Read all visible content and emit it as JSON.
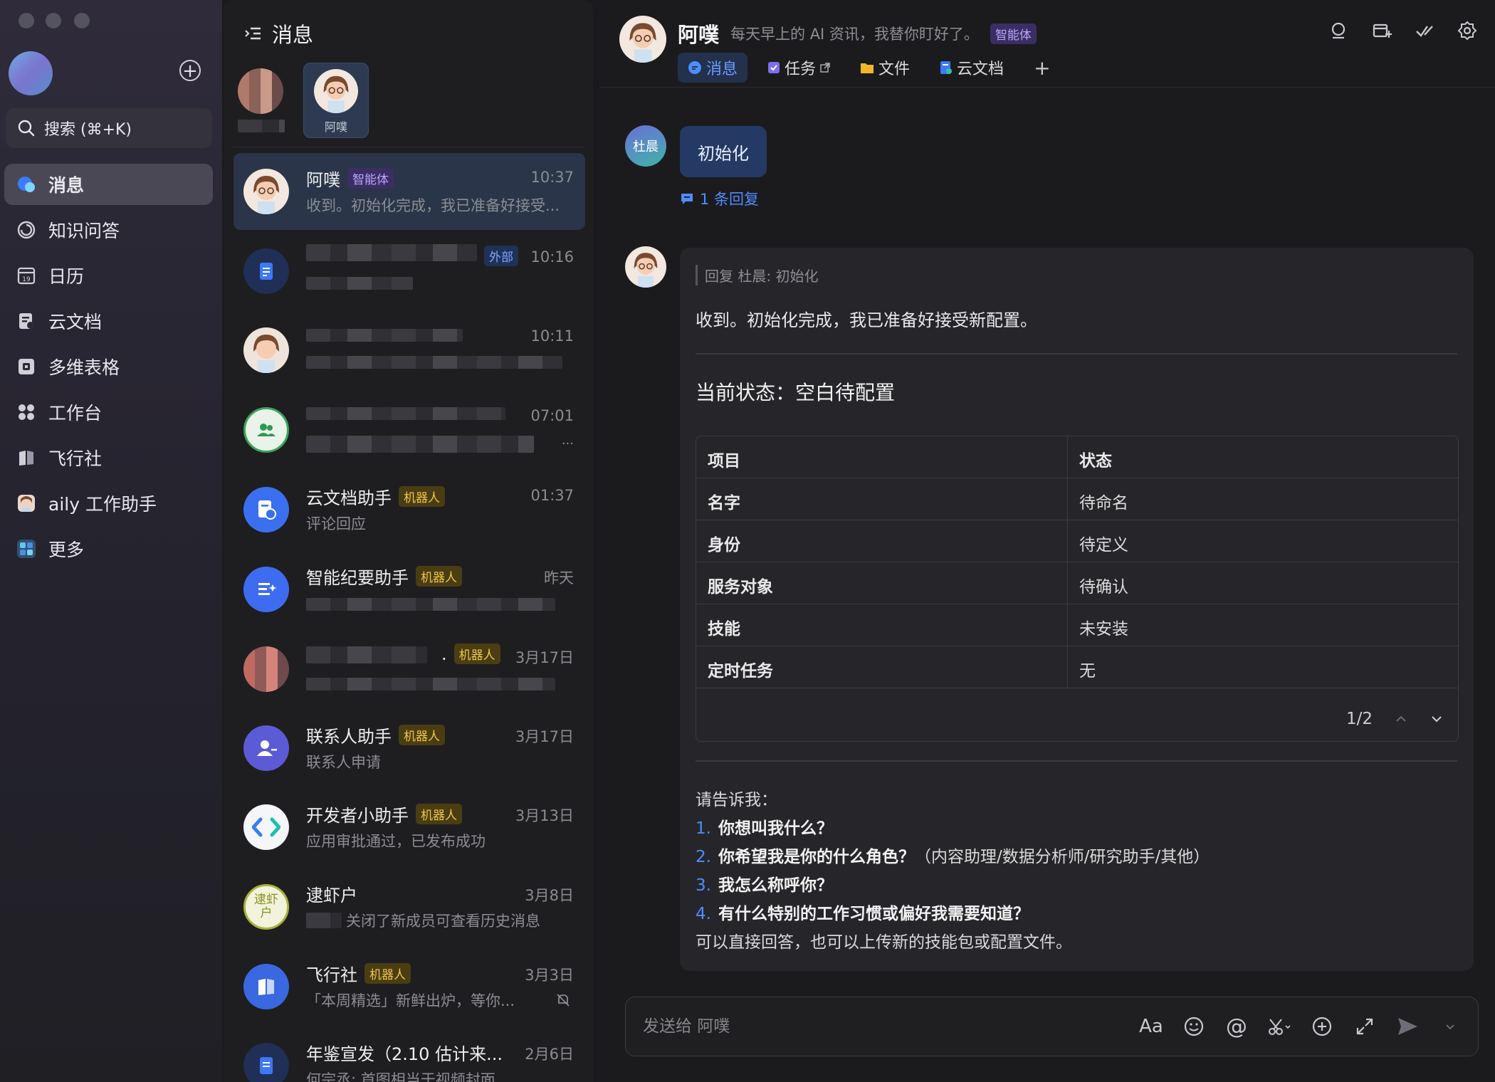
{
  "sidebar": {
    "search_label": "搜索 (⌘+K)",
    "items": [
      {
        "label": "消息",
        "icon": "chat-bubble-icon"
      },
      {
        "label": "知识问答",
        "icon": "spiral-icon"
      },
      {
        "label": "日历",
        "icon": "calendar-icon"
      },
      {
        "label": "云文档",
        "icon": "doc-icon"
      },
      {
        "label": "多维表格",
        "icon": "base-icon"
      },
      {
        "label": "工作台",
        "icon": "grid-icon"
      },
      {
        "label": "飞行社",
        "icon": "book-icon"
      },
      {
        "label": "aily 工作助手",
        "icon": "avatar-icon"
      },
      {
        "label": "更多",
        "icon": "apps-icon"
      }
    ],
    "calendar_day": "19"
  },
  "list": {
    "title": "消息",
    "pinned_name": "阿噗",
    "conversations": [
      {
        "name": "阿噗",
        "badge": "智能体",
        "time": "10:37",
        "preview": "收到。初始化完成，我已准备好接受..."
      },
      {
        "name": "",
        "badge": "外部",
        "time": "10:16",
        "preview": ""
      },
      {
        "name": "",
        "badge": "",
        "time": "10:11",
        "preview": ""
      },
      {
        "name": "",
        "badge": "",
        "time": "07:01",
        "preview": "..."
      },
      {
        "name": "云文档助手",
        "badge": "机器人",
        "time": "01:37",
        "preview": "评论回应"
      },
      {
        "name": "智能纪要助手",
        "badge": "机器人",
        "time": "昨天",
        "preview": ""
      },
      {
        "name": ".",
        "badge": "机器人",
        "time": "3月17日",
        "preview": ""
      },
      {
        "name": "联系人助手",
        "badge": "机器人",
        "time": "3月17日",
        "preview": "联系人申请"
      },
      {
        "name": "开发者小助手",
        "badge": "机器人",
        "time": "3月13日",
        "preview": "应用审批通过，已发布成功"
      },
      {
        "name": "逮虾户",
        "badge": "",
        "time": "3月8日",
        "preview": "关闭了新成员可查看历史消息",
        "avatar_text": "逮虾户"
      },
      {
        "name": "飞行社",
        "badge": "机器人",
        "time": "3月3日",
        "preview": "「本周精选」新鲜出炉，等你..."
      },
      {
        "name": "年鉴宣发（2.10 估计来...",
        "badge": "",
        "time": "2月6日",
        "preview": "何宗丞: 首图相当于视频封面"
      }
    ]
  },
  "chat": {
    "name": "阿噗",
    "description": "每天早上的 AI 资讯，我替你盯好了。",
    "badge": "智能体",
    "tabs": [
      "消息",
      "任务",
      "文件",
      "云文档"
    ],
    "user_avatar_text": "杜晨",
    "user_message": "初始化",
    "reply_count": "1 条回复",
    "quote": "回复 杜晨: 初始化",
    "reply_text": "收到。初始化完成，我已准备好接受新配置。",
    "state_title": "当前状态：空白待配置",
    "table": {
      "headers": [
        "项目",
        "状态"
      ],
      "rows": [
        [
          "名字",
          "待命名"
        ],
        [
          "身份",
          "待定义"
        ],
        [
          "服务对象",
          "待确认"
        ],
        [
          "技能",
          "未安装"
        ],
        [
          "定时任务",
          "无"
        ]
      ],
      "pager": "1/2"
    },
    "ask_intro": "请告诉我：",
    "questions": [
      {
        "n": "1.",
        "q": "你想叫我什么？",
        "extra": ""
      },
      {
        "n": "2.",
        "q": "你希望我是你的什么角色？",
        "extra": "（内容助理/数据分析师/研究助手/其他）"
      },
      {
        "n": "3.",
        "q": "我怎么称呼你？",
        "extra": ""
      },
      {
        "n": "4.",
        "q": "有什么特别的工作习惯或偏好我需要知道？",
        "extra": ""
      }
    ],
    "ask_outro": "可以直接回答，也可以上传新的技能包或配置文件。",
    "composer_placeholder": "发送给 阿噗"
  },
  "colors": {
    "accent": "#4f8cff",
    "robot_badge": "#f0c64a",
    "agent_badge": "#b9a6ff"
  }
}
